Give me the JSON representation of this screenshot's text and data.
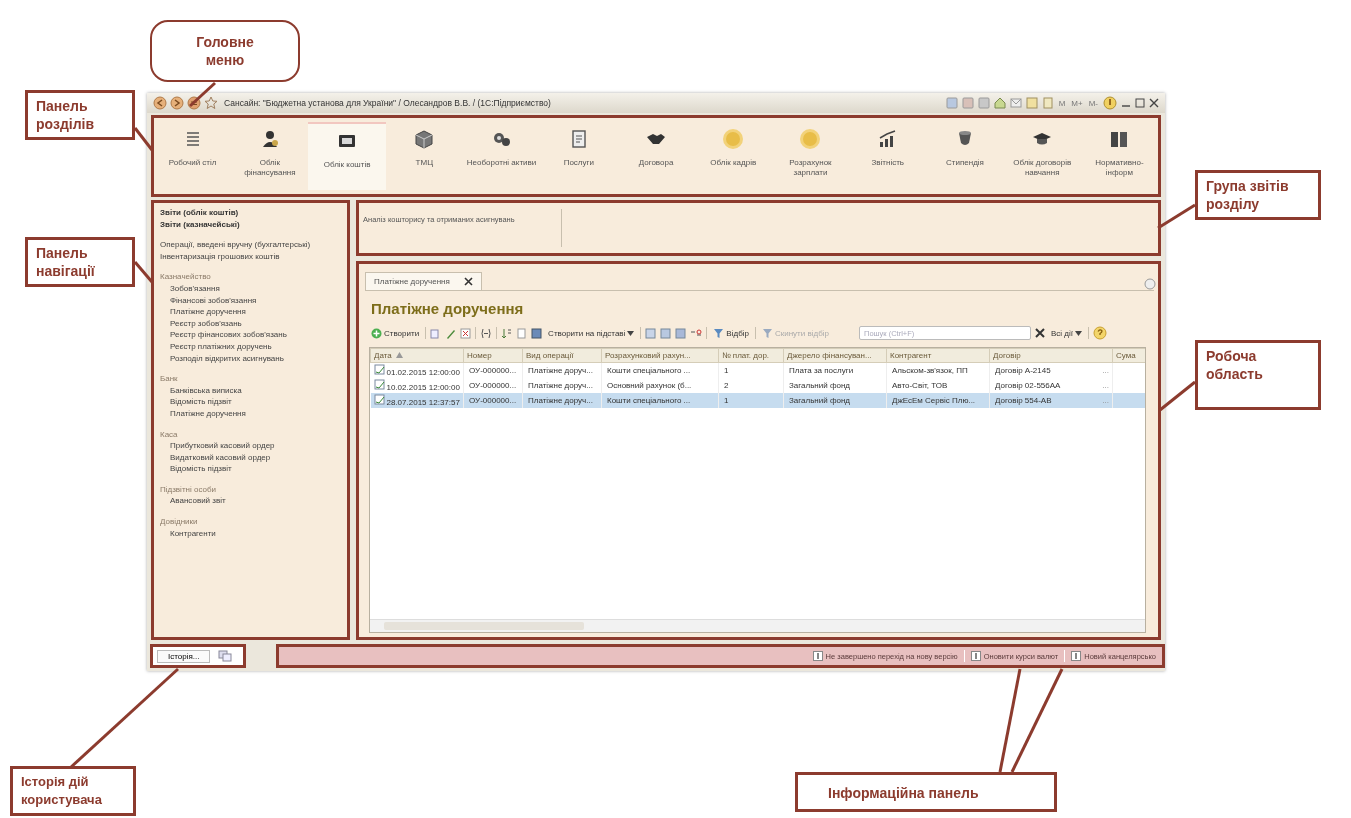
{
  "annotations": [
    {
      "kind": "bubble",
      "text": "Головне меню"
    },
    {
      "kind": "left",
      "text": "Панель розділів"
    },
    {
      "kind": "left",
      "text": "Панель навігації"
    },
    {
      "kind": "right",
      "text": "Група звітів розділу"
    },
    {
      "kind": "right",
      "text": "Робоча область"
    },
    {
      "kind": "bottom",
      "text": "Історія дій користувача"
    },
    {
      "kind": "bottom",
      "text": "Інформаційна панель"
    }
  ],
  "window": {
    "title": "Сансайн: \"Бюджетна установа для України\" / Олесандров В.В. /  (1С:Підприємство)",
    "memory_buttons": [
      "M",
      "M+",
      "M-"
    ]
  },
  "sections": [
    {
      "label": "Робочий стіл",
      "selected": false
    },
    {
      "label": "Облік фінансування",
      "selected": false
    },
    {
      "label": "Облік коштів",
      "selected": true
    },
    {
      "label": "ТМЦ",
      "selected": false
    },
    {
      "label": "Необоротні активи",
      "selected": false
    },
    {
      "label": "Послуги",
      "selected": false
    },
    {
      "label": "Договора",
      "selected": false
    },
    {
      "label": "Облік кадрів",
      "selected": false
    },
    {
      "label": "Розрахунок зарплати",
      "selected": false
    },
    {
      "label": "Звітність",
      "selected": false
    },
    {
      "label": "Стипендія",
      "selected": false
    },
    {
      "label": "Облік договорів навчання",
      "selected": false
    },
    {
      "label": "Нормативно-інформ",
      "selected": false
    }
  ],
  "navigation": {
    "reports": [
      "Звіти (облік коштів)",
      "Звіти (казначейські)"
    ],
    "links": [
      "Операції, введені вручну (бухгалтерські)",
      "Інвентаризація грошових коштів"
    ],
    "groups": [
      {
        "title": "Казначейство",
        "items": [
          "Зобов'язання",
          "Фінансові зобов'язання",
          "Платіжне доручення",
          "Реєстр зобов'язань",
          "Реєстр фінансових зобов'язань",
          "Реєстр платіжних доручень",
          "Розподіл відкритих асигнувань"
        ]
      },
      {
        "title": "Банк",
        "items": [
          "Банківська виписка",
          "Відомість підзвіт",
          "Платіжне доручення"
        ]
      },
      {
        "title": "Каса",
        "items": [
          "Прибутковий касовий ордер",
          "Видатковий касовий ордер",
          "Відомість підзвіт"
        ]
      },
      {
        "title": "Підзвітні особи",
        "items": [
          "Авансовий звіт"
        ]
      },
      {
        "title": "Довідники",
        "items": [
          "Контрагенти"
        ]
      }
    ]
  },
  "report_group": {
    "reports": [
      "Аналіз кошторису та отриманих асигнувань"
    ]
  },
  "tabs": [
    {
      "label": "Платіжне доручення",
      "selected": true
    }
  ],
  "form": {
    "title": "Платіжне доручення",
    "toolbar": {
      "create": "Створити",
      "create_based_on": "Створити на підставі",
      "filter": "Відбір",
      "reset_filter": {
        "label": "Скинути відбір",
        "disabled": true
      },
      "search": {
        "placeholder": "Пошук (Ctrl+F)"
      },
      "all_actions": "Всі дії"
    },
    "table": {
      "columns": [
        "Дата",
        "Номер",
        "Вид операції",
        "Розрахунковий рахун...",
        "№ плат. дор.",
        "Джерело фінансуван...",
        "Контрагент",
        "Договір",
        "Сума"
      ],
      "rows": [
        {
          "selected": false,
          "cells": [
            "01.02.2015 12:00:00",
            "ОУ-000000...",
            "Платіжне доруч...",
            "Кошти спеціального ...",
            "1",
            "Плата за послуги",
            "Альском-зв'язок, ПП",
            "Договір А-2145"
          ],
          "more": "..."
        },
        {
          "selected": false,
          "cells": [
            "10.02.2015 12:00:00",
            "ОУ-000000...",
            "Платіжне доруч...",
            "Основний рахунок (б...",
            "2",
            "Загальний фонд",
            "Авто-Світ, ТОВ",
            "Договір 02-556АА"
          ],
          "more": "..."
        },
        {
          "selected": true,
          "cells": [
            "28.07.2015 12:37:57",
            "ОУ-000000...",
            "Платіжне доруч...",
            "Кошти спеціального ...",
            "1",
            "Загальний фонд",
            "ДжЕсЕм Сервіс Плю...",
            "Договір 554-АВ"
          ],
          "more": "..."
        }
      ]
    }
  },
  "history_button": "Історія...",
  "info_panel": [
    "Не завершено перехід на нову версію",
    "Оновити курси валют",
    "Новий канцелярсько"
  ]
}
